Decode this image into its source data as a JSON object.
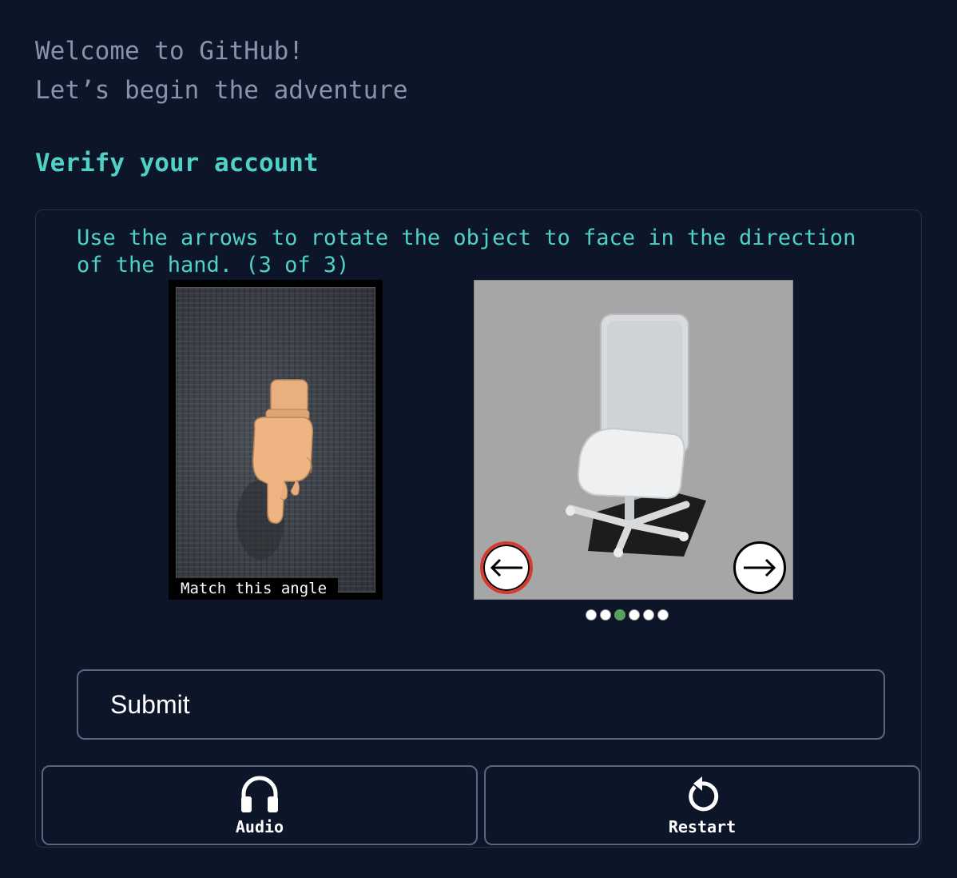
{
  "header": {
    "welcome_line1": "Welcome to GitHub!",
    "welcome_line2": "Let’s begin the adventure"
  },
  "verify": {
    "title": "Verify your account"
  },
  "challenge": {
    "instruction": "Use the arrows to rotate the object to face in the direction of the hand. (3 of 3)",
    "reference_caption": "Match this angle",
    "reference_image": "pointing-hand-icon",
    "object_image": "office-chair-icon",
    "left_arrow_icon": "arrow-left-icon",
    "right_arrow_icon": "arrow-right-icon",
    "dots_total": 6,
    "dots_active_index": 2
  },
  "actions": {
    "submit_label": "Submit",
    "audio_label": "Audio",
    "restart_label": "Restart"
  },
  "colors": {
    "background": "#0d1529",
    "accent": "#4fd1c5",
    "muted_text": "#8a93ae",
    "active_dot": "#5aa05a",
    "left_arrow_ring": "#d63a2f"
  }
}
